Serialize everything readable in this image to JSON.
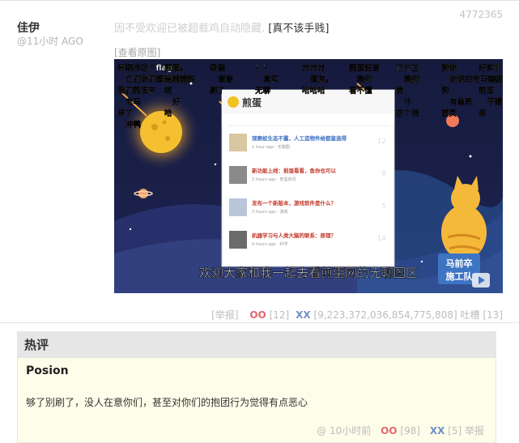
{
  "comment": {
    "author": "佳伊",
    "time": "@11小时 AGO",
    "id": "4772365",
    "hidden_text": "因不受欢迎已被超载鸡自动隐藏.",
    "not_cheap": "[真不该手贱]",
    "view_original": "[查看原图]",
    "report": "[举报]",
    "oo_label": "OO",
    "oo_count": "[12]",
    "xx_label": "XX",
    "xx_count": "[9,223,372,036,854,775,808]",
    "tucao": "吐槽 [13]"
  },
  "video": {
    "subtitle": "欢迎大家和我一起去看煎蛋网的无聊图区",
    "logo_text": "煎蛋",
    "badge_line1": "马前卒",
    "badge_line2": "施工队",
    "danmaku": [
      "好期待这个flag",
      "煎蛋。",
      "吸猫",
      "！！",
      "对对对",
      "煎蛋狂言",
      "方丈在",
      "狗你",
      "好家伙",
      "亡们你们都是新建的",
      "对对",
      "谢谢",
      "真实",
      "蛋友。",
      "晚安",
      "晚安",
      "你说的老马骑狂",
      "有话知道",
      "我们煎蛋友",
      "呢",
      "刷了",
      "无聊",
      "哈哈哈",
      "看不懂",
      "黄",
      "狗",
      "煎蛋",
      "老马",
      "好",
      "牛",
      "有意思",
      "不错",
      "来了",
      "哈",
      "这个流",
      "首页",
      "亲",
      "冲鸭"
    ],
    "webpage": {
      "items": [
        {
          "title": "观察蚁生态不露，人工造物件给都鉴选得",
          "meta": "1 hour ago · 无聊图",
          "count": "12"
        },
        {
          "title": "新功能上线：煎蛋看看，鱼你也可以",
          "meta": "2 hours ago · 煎蛋资讯",
          "count": "8"
        },
        {
          "title": "发布一个新版本，游戏软件是什么？",
          "meta": "3 hours ago · 游戏",
          "count": "5"
        },
        {
          "title": "机器学习与人类大脑的联系：原理？",
          "meta": "4 hours ago · 科学",
          "count": "14"
        }
      ]
    }
  },
  "hot": {
    "title": "热评",
    "user": "Posion",
    "text": "够了别刷了，没人在意你们，甚至对你们的抱团行为觉得有点恶心",
    "meta_at": "@",
    "time": "10小时前",
    "oo_label": "OO",
    "oo_count": "[98]",
    "xx_label": "XX",
    "xx_count": "[5]",
    "report": "举报"
  },
  "colors": {
    "accent_oo": "#e0666f",
    "accent_xx": "#6f90c7",
    "hot_bg": "#fefde9",
    "hot_head": "#e6e6e6",
    "video_sky": "#13183a"
  }
}
